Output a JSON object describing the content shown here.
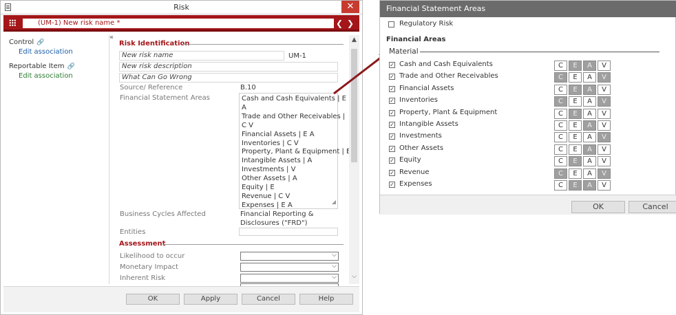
{
  "risk_window": {
    "title": "Risk",
    "close_glyph": "✕",
    "header": {
      "risk_id_name": "(UM-1)  New risk name *",
      "prev_glyph": "❮",
      "next_glyph": "❯"
    },
    "left_panel": {
      "control_label": "Control",
      "control_link": "Edit association",
      "reportable_label": "Reportable Item",
      "reportable_link": "Edit association",
      "collapse_glyph": "«"
    },
    "risk_identification": {
      "section_title": "Risk Identification",
      "name_value": "New risk name",
      "id_value": "UM-1",
      "description_value": "New risk description",
      "what_can_go_wrong_value": "What Can Go Wrong",
      "source_label": "Source/ Reference",
      "source_value": "B.10",
      "fsa_label": "Financial Statement Areas",
      "fsa_lines": [
        "Cash and Cash Equivalents | E",
        "A",
        "Trade and Other Receivables |",
        "C V",
        "Financial Assets | E A",
        "Inventories | C V",
        "Property, Plant & Equipment | E",
        "Intangible Assets | A",
        "Investments | V",
        "Other Assets | A",
        "Equity | E",
        "Revenue | C V",
        "Expenses | E A"
      ],
      "business_cycles_label": "Business Cycles Affected",
      "business_cycles_value_1": "Financial Reporting &",
      "business_cycles_value_2": "Disclosures (\"FRD\")",
      "entities_label": "Entities"
    },
    "assessment": {
      "section_title": "Assessment",
      "likelihood_label": "Likelihood to occur",
      "monetary_label": "Monetary Impact",
      "inherent_label": "Inherent Risk"
    },
    "footer": {
      "ok": "OK",
      "apply": "Apply",
      "cancel": "Cancel",
      "help": "Help"
    }
  },
  "fsa_dialog": {
    "title": "Financial Statement Areas",
    "regulatory_risk_label": "Regulatory Risk",
    "financial_areas_heading": "Financial Areas",
    "material_heading": "Material",
    "ceav_letters": [
      "C",
      "E",
      "A",
      "V"
    ],
    "rows": [
      {
        "label": "Cash and Cash Equivalents",
        "checked": true,
        "on": [
          false,
          true,
          true,
          false
        ]
      },
      {
        "label": "Trade and Other Receivables",
        "checked": true,
        "on": [
          true,
          false,
          false,
          true
        ]
      },
      {
        "label": "Financial Assets",
        "checked": true,
        "on": [
          false,
          true,
          true,
          false
        ]
      },
      {
        "label": "Inventories",
        "checked": true,
        "on": [
          true,
          false,
          false,
          true
        ]
      },
      {
        "label": "Property, Plant & Equipment",
        "checked": true,
        "on": [
          false,
          true,
          false,
          false
        ]
      },
      {
        "label": "Intangible Assets",
        "checked": true,
        "on": [
          false,
          false,
          true,
          false
        ]
      },
      {
        "label": "Investments",
        "checked": true,
        "on": [
          false,
          false,
          false,
          true
        ]
      },
      {
        "label": "Other Assets",
        "checked": true,
        "on": [
          false,
          false,
          true,
          false
        ]
      },
      {
        "label": "Equity",
        "checked": true,
        "on": [
          false,
          true,
          false,
          false
        ]
      },
      {
        "label": "Revenue",
        "checked": true,
        "on": [
          true,
          false,
          false,
          true
        ]
      },
      {
        "label": "Expenses",
        "checked": true,
        "on": [
          false,
          true,
          true,
          false
        ]
      }
    ],
    "footer": {
      "ok": "OK",
      "cancel": "Cancel"
    }
  },
  "colors": {
    "brand_red": "#a41619",
    "close_red": "#c73b2f",
    "link_blue": "#1d5fa8",
    "link_green": "#2e7d32",
    "dialog_title_gray": "#6b6b6b",
    "toggle_on_gray": "#9f9f9f"
  }
}
